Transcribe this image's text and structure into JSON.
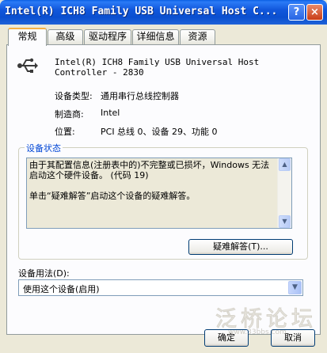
{
  "window": {
    "title": "Intel(R) ICH8 Family USB Universal Host C...",
    "help_button": "?",
    "close_button": "×"
  },
  "tabs": [
    {
      "label": "常规",
      "active": true
    },
    {
      "label": "高级",
      "active": false
    },
    {
      "label": "驱动程序",
      "active": false
    },
    {
      "label": "详细信息",
      "active": false
    },
    {
      "label": "资源",
      "active": false
    }
  ],
  "device": {
    "icon": "usb-icon",
    "name": "Intel(R) ICH8 Family USB Universal Host\nController - 2830"
  },
  "properties": [
    {
      "label": "设备类型:",
      "value": "通用串行总线控制器"
    },
    {
      "label": "制造商:",
      "value": "Intel"
    },
    {
      "label": "位置:",
      "value": "PCI 总线 0、设备 29、功能 0"
    }
  ],
  "status": {
    "group_title": "设备状态",
    "lines": [
      "由于其配置信息(注册表中的)不完整或已损坏，Windows 无法启动这个硬件设备。 (代码 19)",
      "单击“疑难解答”启动这个设备的疑难解答。"
    ],
    "troubleshoot_button": "疑难解答(T)..."
  },
  "usage": {
    "label": "设备用法(D):",
    "selected": "使用这个设备(启用)"
  },
  "buttons": {
    "ok": "确定",
    "cancel": "取消"
  },
  "watermark": {
    "text": "泛桥论坛",
    "url": "www.33bbs.com"
  },
  "colors": {
    "titlebar": "#0A4FD0",
    "dialog_bg": "#ECE9D8",
    "group_title": "#0046D5",
    "active_tab_accent": "#F7B043"
  }
}
